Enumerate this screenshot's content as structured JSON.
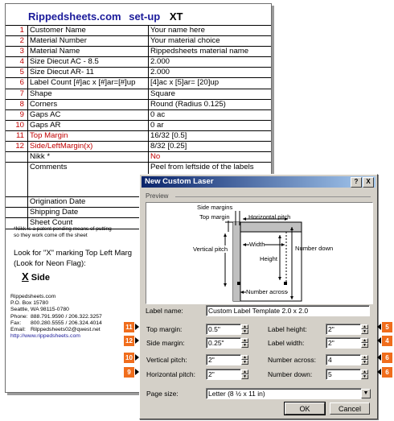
{
  "sheet": {
    "brand": "Rippedsheets.com",
    "setup": "set-up",
    "product": "XT",
    "rows": [
      {
        "num": "1",
        "label": "Customer Name",
        "value": "Your name here"
      },
      {
        "num": "2",
        "label": "Material Number",
        "value": "Your material choice"
      },
      {
        "num": "3",
        "label": "Material Name",
        "value": "Rippedsheets material name"
      },
      {
        "num": "4",
        "label": "Size Diecut AC - 8.5",
        "value": "2.000"
      },
      {
        "num": "5",
        "label": "Size Diecut AR- 11",
        "value": "2.000"
      },
      {
        "num": "6",
        "label": "Label Count [#]ac x [#]ar=[#]up",
        "value": "[4]ac x [5]ar= [20]up"
      },
      {
        "num": "7",
        "label": "Shape",
        "value": "Square"
      },
      {
        "num": "8",
        "label": "Corners",
        "value": "Round (Radius 0.125)"
      },
      {
        "num": "9",
        "label": "Gaps AC",
        "value": "0 ac"
      },
      {
        "num": "10",
        "label": "Gaps AR",
        "value": "0 ar"
      },
      {
        "num": "11",
        "label": "Top Margin",
        "value": "16/32 [0.5]"
      },
      {
        "num": "12",
        "label": "Side/LeftMargin(x)",
        "value": "8/32 [0.25]"
      }
    ],
    "nikk_label": "Nikk *",
    "nikk_value": "No",
    "comments_label": "Comments",
    "comments_value": "Peel from leftside of the labels",
    "origination_label": "Origination Date",
    "shipping_label": "Shipping Date",
    "sheetcount_label": "Sheet Count",
    "footnote_line1": "*Nikk is a patent pending means of putting",
    "footnote_line2": "so they work come off the sheet",
    "look_line1": "Look for \"X\" marking Top Left Marg",
    "look_line2": "(Look for Neon Flag):",
    "xside_x": "X",
    "xside_text": "Side",
    "contact": {
      "name": "Rippedsheets.com",
      "pobox": "P.O. Box 15780",
      "city": "Seattle, WA 98115-0780",
      "phone_label": "Phone:",
      "phone": "888.791.9590 / 206.322.3257",
      "fax_label": "Fax:",
      "fax": "800.280.5555 / 206.324.4014",
      "email_label": "Email:",
      "email": "Rilppedsheets02@qwest.net",
      "url": "http://www.rippedsheets.com"
    }
  },
  "dialog": {
    "title": "New Custom Laser",
    "help_button": "?",
    "close_button": "X",
    "preview_label": "Preview",
    "diagram": {
      "side_margins": "Side margins",
      "top_margin": "Top margin",
      "horizontal_pitch": "Horizontal pitch",
      "width": "Width",
      "vertical_pitch": "Vertical pitch",
      "height": "Height",
      "number_down": "Number down",
      "number_across": "Number across"
    },
    "label_name_label": "Label name:",
    "label_name_value": "Custom Label Template 2.0 x 2.0",
    "fields": {
      "top_margin": {
        "label": "Top margin:",
        "value": "0.5\"",
        "badge": "11"
      },
      "side_margin": {
        "label": "Side margin:",
        "value": "0.25\"",
        "badge": "12"
      },
      "vertical_pitch": {
        "label": "Vertical pitch:",
        "value": "2\"",
        "badge": "10"
      },
      "horizontal_pitch": {
        "label": "Horizontal pitch:",
        "value": "2\"",
        "badge": "9"
      },
      "label_height": {
        "label": "Label height:",
        "value": "2\"",
        "badge": "5"
      },
      "label_width": {
        "label": "Label width:",
        "value": "2\"",
        "badge": "4"
      },
      "number_across": {
        "label": "Number across:",
        "value": "4",
        "badge": "6"
      },
      "number_down": {
        "label": "Number down:",
        "value": "5",
        "badge": "6"
      }
    },
    "page_size_label": "Page size:",
    "page_size_value": "Letter (8 ½ x 11 in)",
    "ok_label": "OK",
    "cancel_label": "Cancel"
  },
  "colors": {
    "brand_blue": "#1a1a9a",
    "row_number_red": "#c00000",
    "titlebar_start": "#0a246a",
    "titlebar_end": "#a6caf0",
    "dialog_face": "#d4d0c8",
    "badge_orange": "#f06d1c"
  }
}
